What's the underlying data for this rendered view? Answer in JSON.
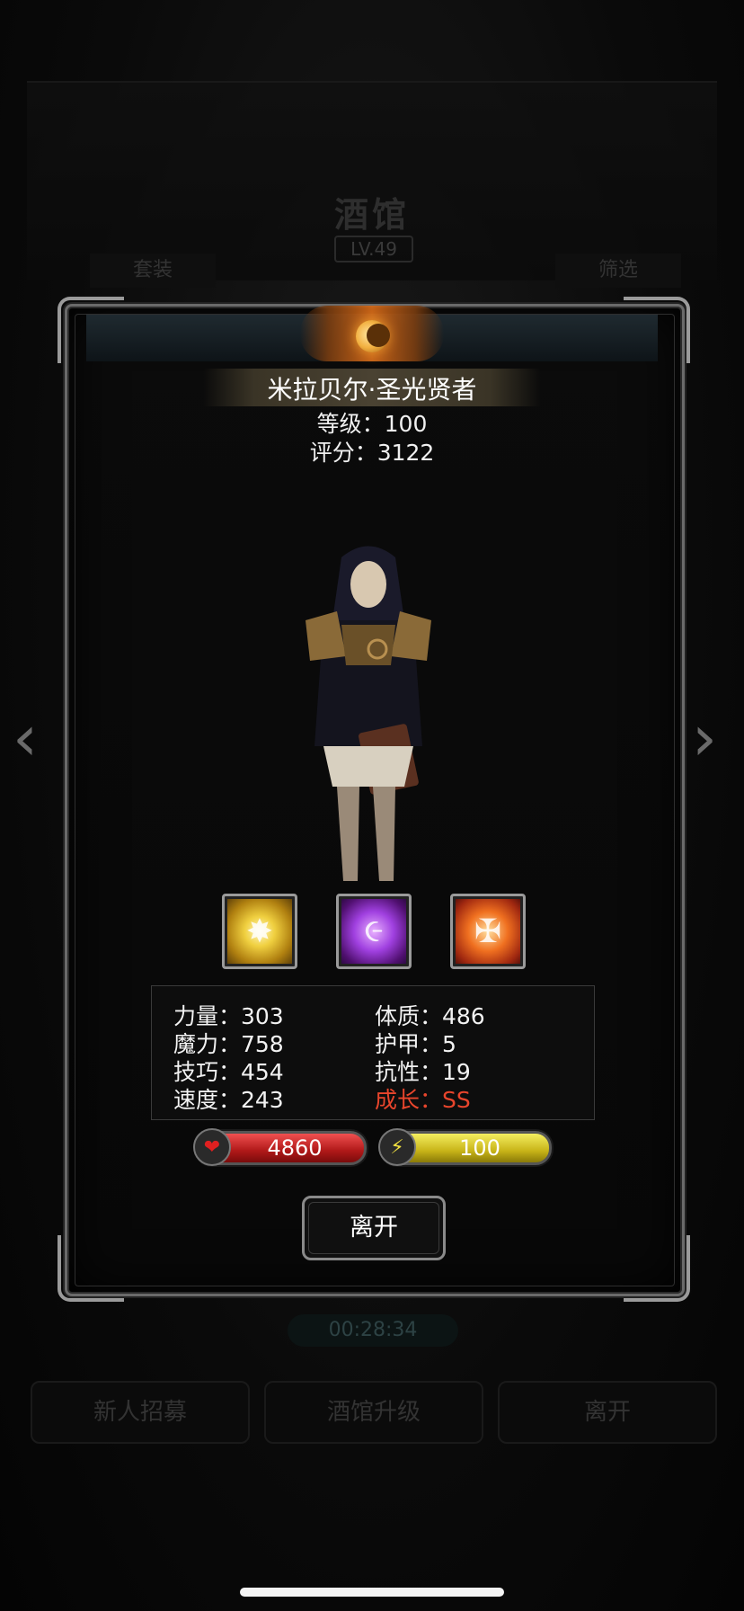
{
  "background": {
    "title": "酒馆",
    "level": "LV.49",
    "tab_left": "套装",
    "tab_right": "筛选",
    "timer": "00:28:34",
    "buttons": [
      "新人招募",
      "酒馆升级",
      "离开"
    ]
  },
  "hero": {
    "name": "米拉贝尔·圣光贤者",
    "level_text": "等级：100",
    "score_text": "评分：3122"
  },
  "skills": [
    {
      "icon": "holy-burst-icon"
    },
    {
      "icon": "arcane-rune-icon"
    },
    {
      "icon": "sacred-cross-icon"
    }
  ],
  "stats": {
    "strength": "力量：303",
    "magic": "魔力：758",
    "skill": "技巧：454",
    "speed": "速度：243",
    "constitution": "体质：486",
    "armor": "护甲：5",
    "resistance": "抗性：19",
    "growth": "成长：SS"
  },
  "bars": {
    "hp": "4860",
    "energy": "100"
  },
  "leave_button": "离开",
  "colors": {
    "growth": "#e8452c",
    "hp_bar": "#c02020",
    "energy_bar": "#d0c020",
    "frame": "#8a8a8a"
  }
}
